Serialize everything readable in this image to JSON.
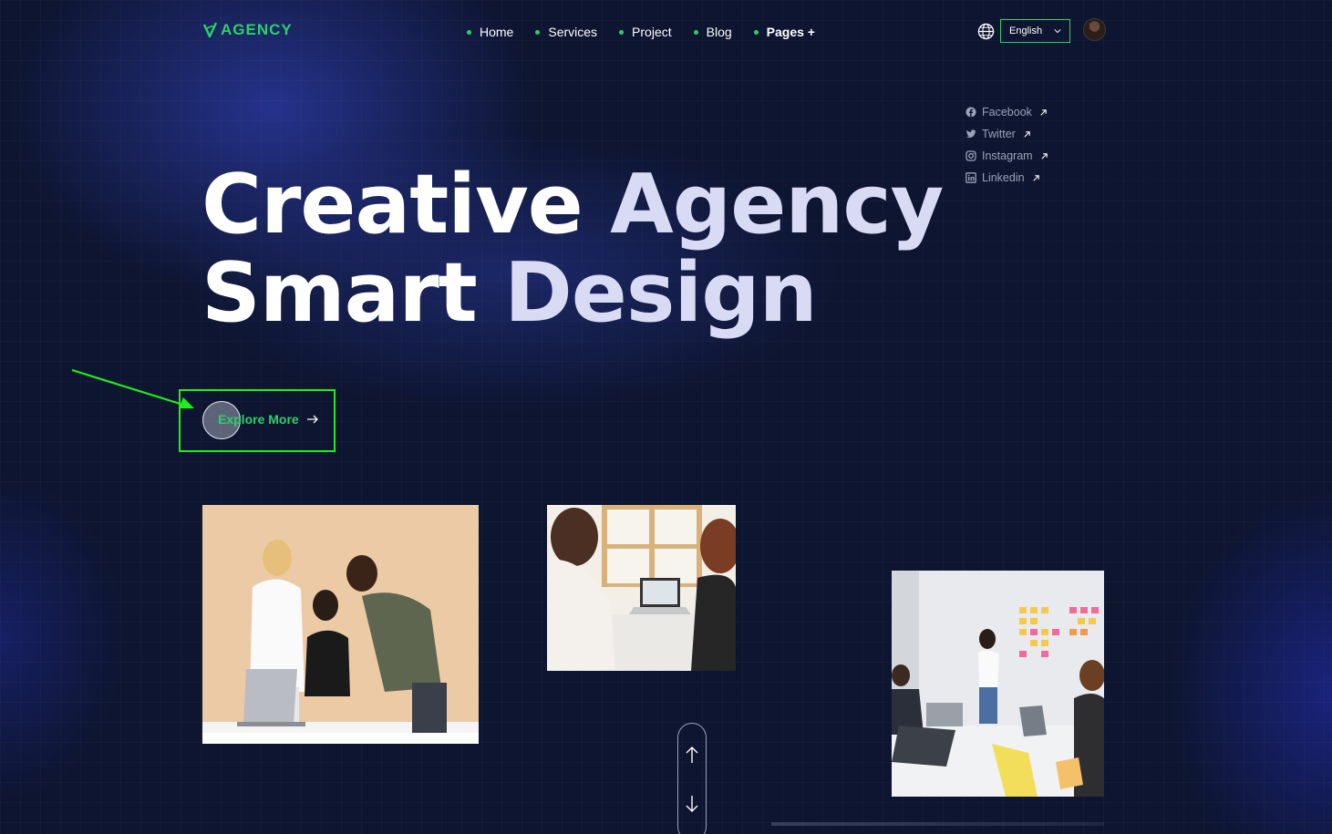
{
  "header": {
    "logo_text": "AGENCY",
    "nav": [
      {
        "label": "Home"
      },
      {
        "label": "Services"
      },
      {
        "label": "Project"
      },
      {
        "label": "Blog"
      },
      {
        "label": "Pages +"
      }
    ],
    "language": "English"
  },
  "socials": [
    {
      "label": "Facebook",
      "icon": "facebook-icon"
    },
    {
      "label": "Twitter",
      "icon": "twitter-icon"
    },
    {
      "label": "Instagram",
      "icon": "instagram-icon"
    },
    {
      "label": "Linkedin",
      "icon": "linkedin-icon"
    }
  ],
  "hero": {
    "line1_word1": "Creative",
    "line1_word2": "Agency",
    "line2_word1": "Smart",
    "line2_word2": "Design",
    "cta_label": "Explore More"
  },
  "colors": {
    "accent": "#2bd06a",
    "background": "#0d1530",
    "highlight_box": "#1bf01b"
  }
}
